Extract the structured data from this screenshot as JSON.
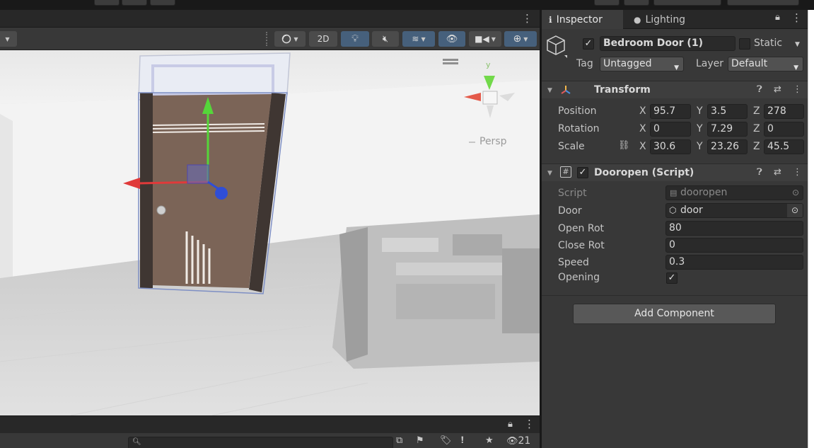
{
  "scene": {
    "toolbar": {
      "mode_2d": "2D"
    },
    "viewport": {
      "projection_label": "Persp",
      "gizmo_axis_y": "y"
    }
  },
  "inspector": {
    "tabs": [
      {
        "label": "Inspector",
        "icon": "info-icon",
        "active": true
      },
      {
        "label": "Lighting",
        "icon": "bulb-icon",
        "active": false
      }
    ],
    "object": {
      "name": "Bedroom Door (1)",
      "active": true,
      "static_label": "Static",
      "tag_label": "Tag",
      "tag_value": "Untagged",
      "layer_label": "Layer",
      "layer_value": "Default"
    },
    "transform": {
      "title": "Transform",
      "position_label": "Position",
      "rotation_label": "Rotation",
      "scale_label": "Scale",
      "position": {
        "x": "95.7",
        "y": "3.5",
        "z": "278"
      },
      "rotation": {
        "x": "0",
        "y": "7.29",
        "z": "0"
      },
      "scale": {
        "x": "30.6",
        "y": "23.26",
        "z": "45.5"
      }
    },
    "script_component": {
      "title": "Dooropen (Script)",
      "enabled": true,
      "fields": {
        "script_label": "Script",
        "script_value": "dooropen",
        "door_label": "Door",
        "door_value": "door",
        "open_rot_label": "Open Rot",
        "open_rot_value": "80",
        "close_rot_label": "Close Rot",
        "close_rot_value": "0",
        "speed_label": "Speed",
        "speed_value": "0.3",
        "opening_label": "Opening",
        "opening_value": true
      }
    },
    "add_component_label": "Add Component"
  },
  "bottom": {
    "hidden_count": "21"
  },
  "colors": {
    "accent": "#46607c",
    "axis_x": "#e03a3a",
    "axis_y": "#55d63a",
    "axis_z": "#2f4ed6"
  },
  "axes": {
    "x": "X",
    "y": "Y",
    "z": "Z"
  }
}
